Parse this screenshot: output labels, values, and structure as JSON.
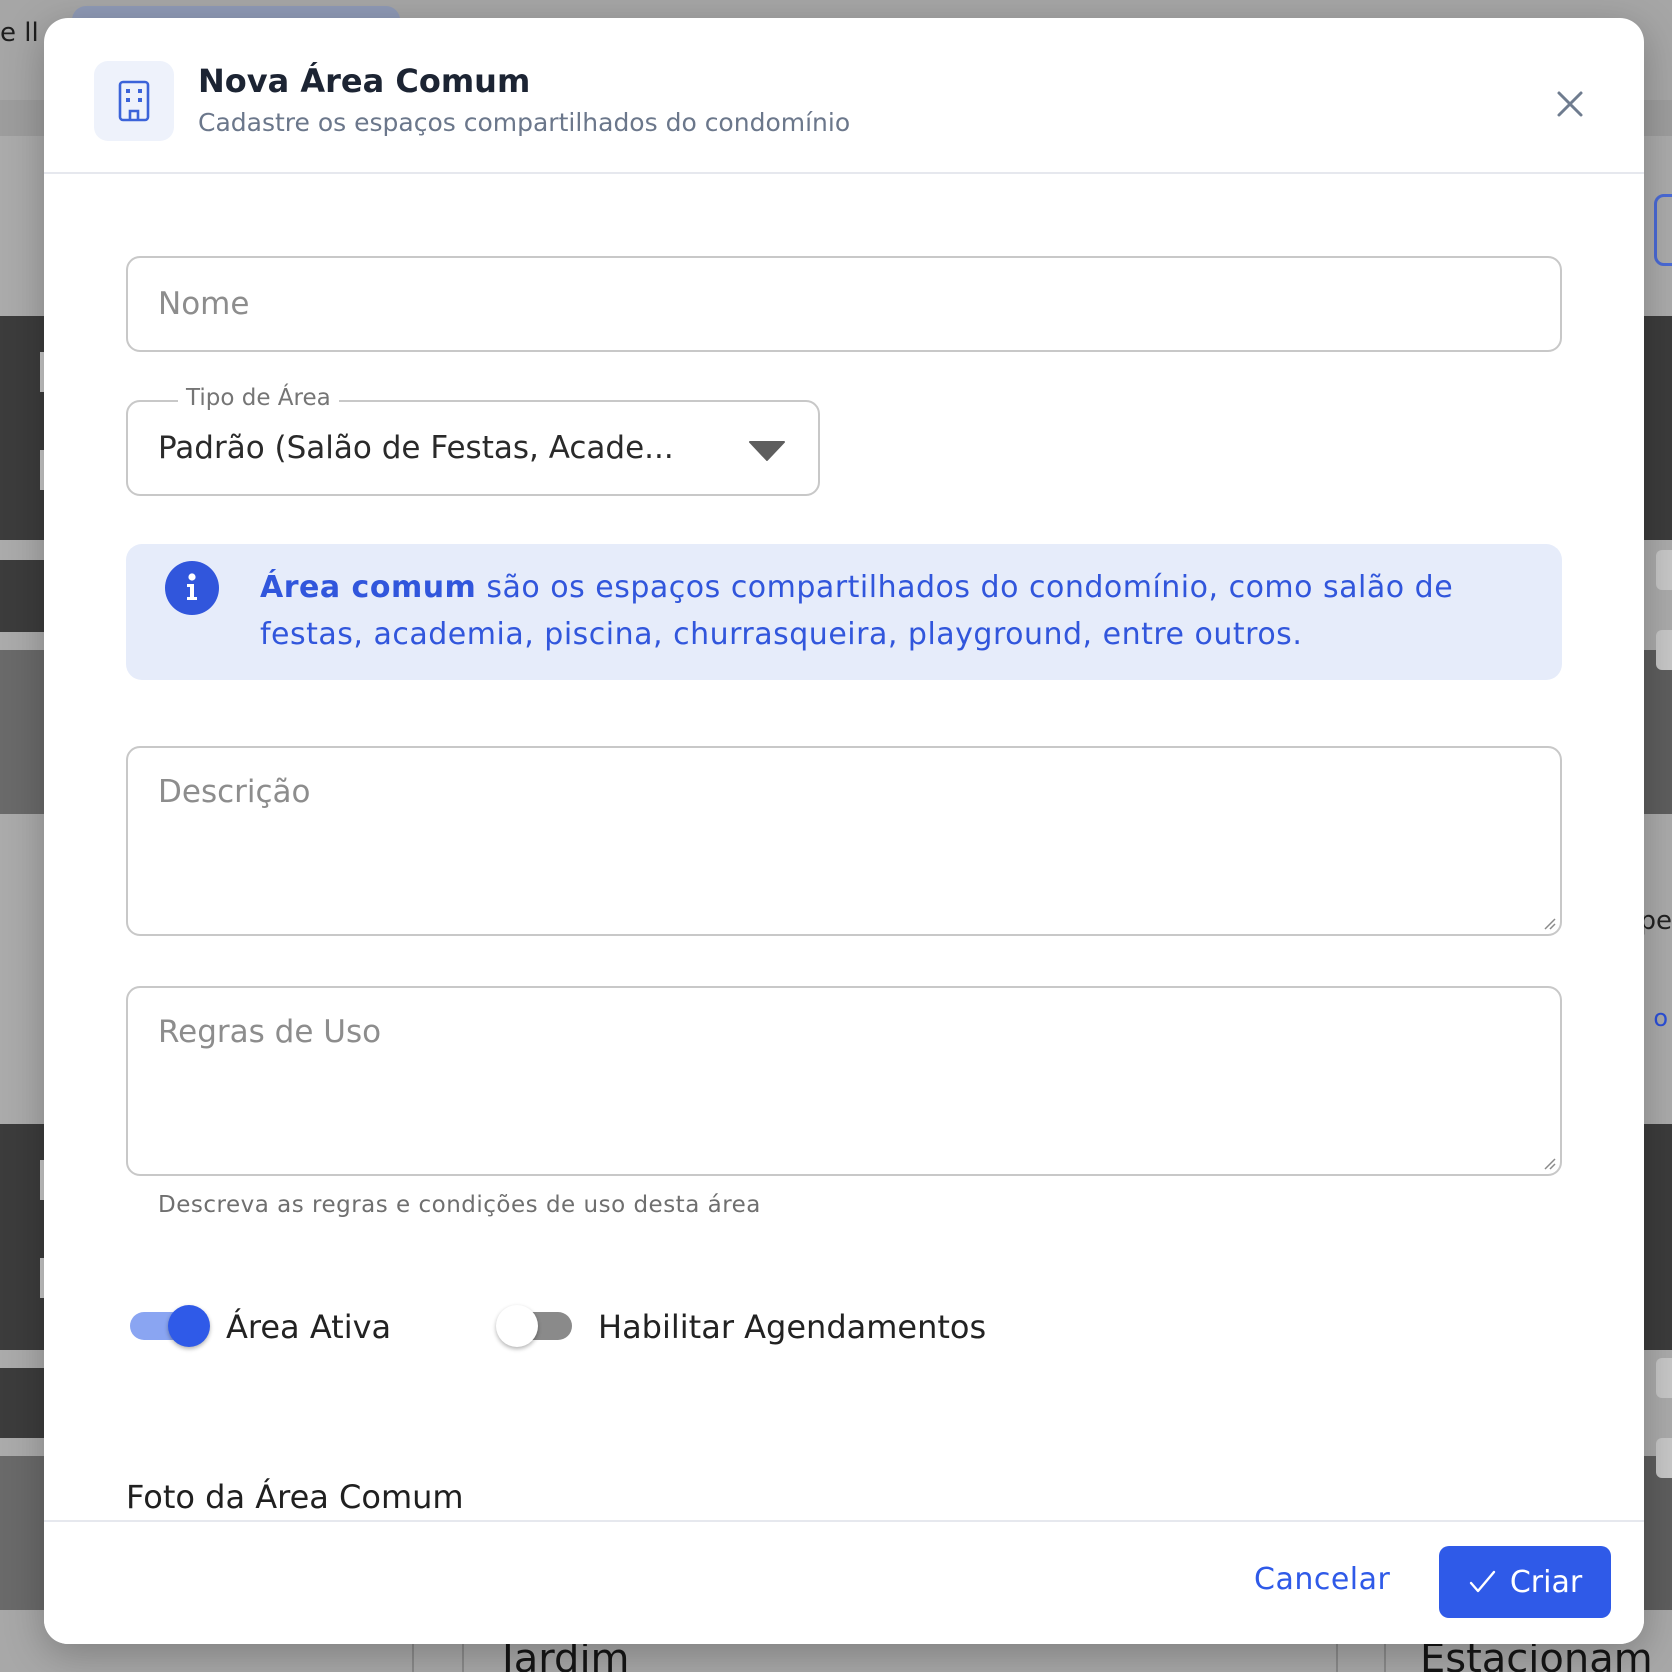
{
  "background": {
    "topbar_text": "e ll",
    "edge_text": "pe",
    "edge_link": "o",
    "bottom_cards": [
      "Jardim",
      "Estacionam"
    ]
  },
  "modal": {
    "icon": "building-icon",
    "title": "Nova Área Comum",
    "subtitle": "Cadastre os espaços compartilhados do condomínio",
    "close_icon": "close-icon"
  },
  "form": {
    "name": {
      "placeholder": "Nome",
      "value": ""
    },
    "area_type": {
      "label": "Tipo de Área",
      "value": "Padrão (Salão de Festas, Acade...",
      "icon": "chevron-down-icon"
    },
    "info": {
      "icon": "info-icon",
      "bold": "Área comum",
      "text": " são os espaços compartilhados do condomínio, como salão de festas, academia, piscina, churrasqueira, playground, entre outros."
    },
    "description": {
      "placeholder": "Descrição",
      "value": ""
    },
    "rules": {
      "placeholder": "Regras de Uso",
      "value": "",
      "helper": "Descreva as regras e condições de uso desta área"
    },
    "toggles": [
      {
        "label": "Área Ativa",
        "checked": true
      },
      {
        "label": "Habilitar Agendamentos",
        "checked": false
      }
    ],
    "photo_section_title": "Foto da Área Comum"
  },
  "footer": {
    "cancel_label": "Cancelar",
    "create_label": "Criar",
    "create_icon": "check-icon"
  },
  "colors": {
    "primary": "#2f5ae8",
    "info_bg": "#e6ecfa",
    "info_text": "#3156dc",
    "title": "#1c2433",
    "subtitle": "#6b778b"
  }
}
